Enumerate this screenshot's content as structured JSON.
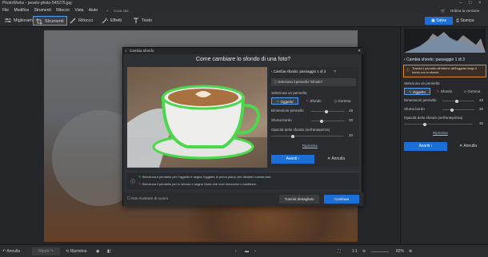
{
  "window": {
    "title": "PhotoWorks - pexels-photo-545275.jpg",
    "search_placeholder": "Cosa stai cercando?",
    "upgrade_label": "Ordina la versione completa"
  },
  "menu": [
    "File",
    "Modifica",
    "Strumenti",
    "Ritocco",
    "Vista",
    "Aiuto"
  ],
  "toolbar": {
    "tabs": [
      {
        "label": "Miglioramento",
        "icon": "sliders-icon"
      },
      {
        "label": "Strumenti",
        "icon": "crop-icon"
      },
      {
        "label": "Ritocco",
        "icon": "brush-icon"
      },
      {
        "label": "Effetti",
        "icon": "effects-icon"
      },
      {
        "label": "Testo",
        "icon": "text-icon"
      }
    ],
    "save_label": "Salva",
    "print_label": "Stampa"
  },
  "right_panel": {
    "header": "Cambia sfondo: passaggio 1 di 3",
    "hint": "Traccia il pennello all'interno dell'oggetto lungo il bordo con lo sfondo.",
    "brush_label": "Seleziona un pennello:",
    "brushes": [
      "Oggetto",
      "Sfondo",
      "Gomma"
    ],
    "sliders": [
      {
        "label": "Dimensioni pennello",
        "value": "48",
        "level": 0.45
      },
      {
        "label": "Sfuma bordo",
        "value": "30",
        "level": 0.3
      },
      {
        "label": "Opacità dello sfondo (nell'anteprima)",
        "value": "30",
        "level": 0.3
      }
    ],
    "reset_label": "Ripristina",
    "next_label": "Avanti",
    "cancel_label": "Annulla"
  },
  "modal": {
    "title": "Cambia sfondo",
    "heading": "Come cambiare lo sfondo di una foto?",
    "step_header": "Cambia sfondo: passaggio 1 di 3",
    "step_hint": "Seleziona il pennello \"Sfondo\".",
    "brush_label": "Seleziona un pennello:",
    "brushes": [
      "Oggetto",
      "Sfondo",
      "Gomma"
    ],
    "sliders": [
      {
        "label": "Dimensioni pennello",
        "value": "48",
        "level": 0.45
      },
      {
        "label": "Sfuma bordo",
        "value": "30",
        "level": 0.3
      },
      {
        "label": "Opacità dello sfondo (nell'anteprima)",
        "value": "30",
        "level": 0.3
      }
    ],
    "reset_label": "Ripristina",
    "next_label": "Avanti",
    "cancel_label": "Annulla",
    "tips": [
      "Seleziona il pennello per l'oggetto e segna l'oggetto in primo piano che desideri conservare.",
      "Seleziona il pennello per lo sfondo e segna l'area che vuoi rimuovere o sostituire."
    ],
    "dont_show_label": "Non mostrare di nuovo",
    "tutorial_label": "Tutorial dettagliato",
    "continue_label": "Continua"
  },
  "status": {
    "undo_label": "Annulla",
    "redo_label": "Ripeti",
    "reset_label": "Ripristina",
    "ratio_label": "1:1",
    "zoom": "82%"
  },
  "colors": {
    "accent": "#1d6fd8",
    "brush_green": "#4cd84c",
    "brush_red": "#e0473b",
    "hint_border": "#e08a2b"
  }
}
